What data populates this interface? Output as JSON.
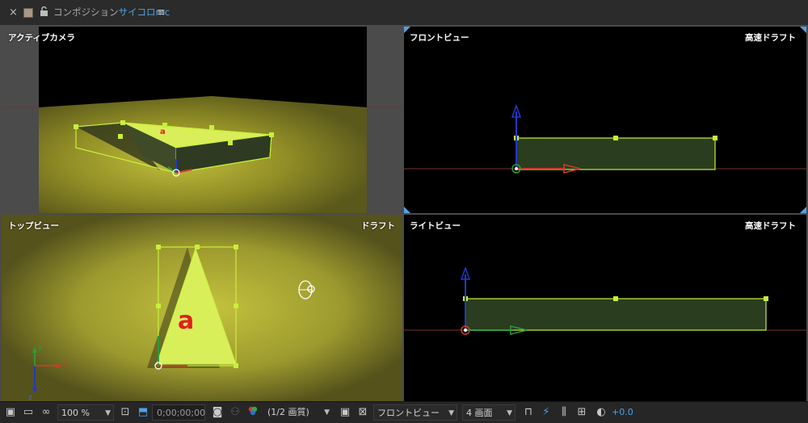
{
  "tab": {
    "close_icon": "×",
    "lock_icon": "lock-icon",
    "title_prefix": "コンポジション",
    "title_comp": "サイコロmc",
    "menu_icon": "≡"
  },
  "views": {
    "active_camera": {
      "label": "アクティブカメラ",
      "quality": ""
    },
    "front": {
      "label": "フロントビュー",
      "quality": "高速ドラフト"
    },
    "top": {
      "label": "トップビュー",
      "quality": "ドラフト"
    },
    "right": {
      "label": "ライトビュー",
      "quality": "高速ドラフト"
    }
  },
  "layer_letter": "a",
  "axes": {
    "x": "x",
    "y": "y",
    "z": "z"
  },
  "colors": {
    "accent_blue": "#4ea3e6",
    "layer_green": "#c8f03a",
    "solid_yellow": "#bcba36",
    "x_axis": "#d23a2a",
    "y_axis": "#2f9a3c",
    "z_axis": "#2438c8"
  },
  "toolbar": {
    "zoom": "100 %",
    "timecode": "0;00;00;00",
    "resolution": "(1/2 画質)",
    "view": "フロントビュー",
    "layout": "4 画面",
    "exposure": "+0.0"
  }
}
